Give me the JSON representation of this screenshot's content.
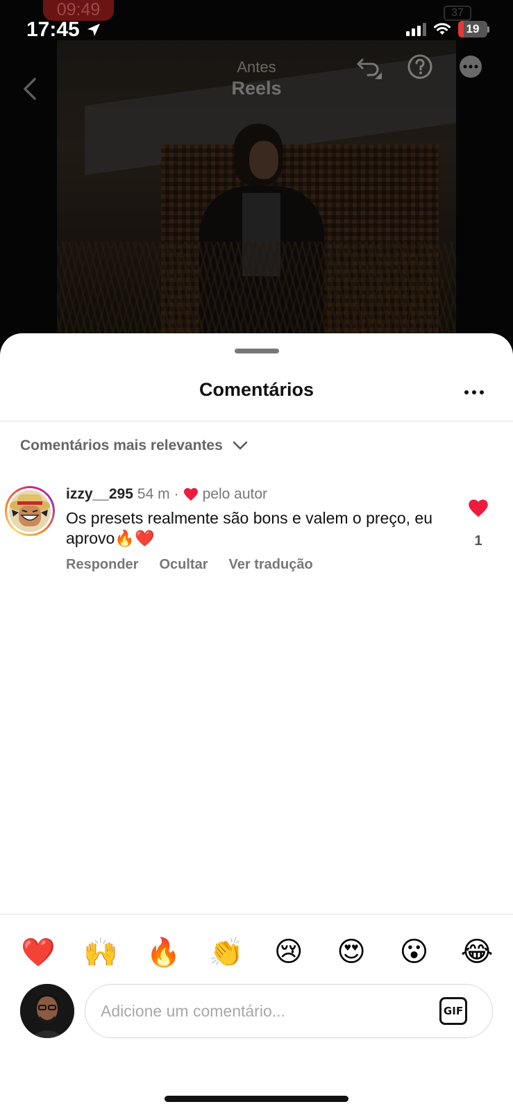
{
  "status_bar": {
    "time": "17:45",
    "battery_level": "19",
    "ghost_time": "09:49",
    "ghost_battery": "37"
  },
  "video": {
    "overlay_subtitle": "Antes",
    "overlay_title": "Reels"
  },
  "sheet": {
    "title": "Comentários",
    "sort_label": "Comentários mais relevantes"
  },
  "comments": [
    {
      "username": "izzy__295",
      "time": "54 m",
      "separator": "·",
      "author_like": "pelo autor",
      "text": "Os presets realmente são bons e valem o preço, eu aprovo🔥❤️",
      "like_count": "1",
      "actions": {
        "reply": "Responder",
        "hide": "Ocultar",
        "translate": "Ver tradução"
      }
    }
  ],
  "emoji_bar": [
    "❤️",
    "🙌",
    "🔥",
    "👏",
    "😢",
    "😍",
    "😮",
    "😂"
  ],
  "composer": {
    "placeholder": "Adicione um comentário...",
    "gif_label": "GIF"
  },
  "colors": {
    "like_red": "#ed1c3f",
    "battery_red": "#e53935",
    "muted_text": "#777777"
  }
}
